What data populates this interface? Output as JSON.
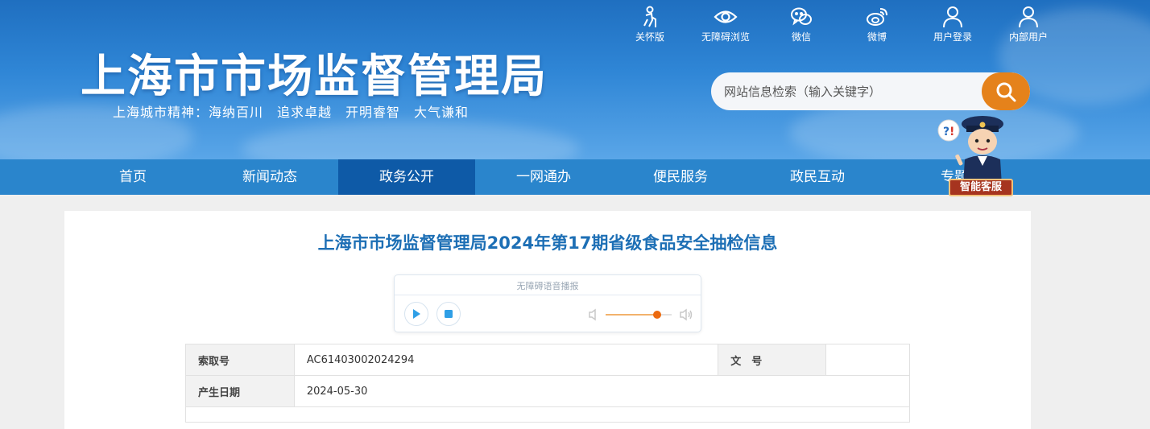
{
  "header": {
    "site_title": "上海市市场监督管理局",
    "site_slogan": "上海城市精神：海纳百川　追求卓越　开明睿智　大气谦和",
    "top_links": [
      {
        "label": "关怀版",
        "icon": "elderly-care-icon"
      },
      {
        "label": "无障碍浏览",
        "icon": "eye-icon"
      },
      {
        "label": "微信",
        "icon": "wechat-icon"
      },
      {
        "label": "微博",
        "icon": "weibo-icon"
      },
      {
        "label": "用户登录",
        "icon": "user-icon"
      },
      {
        "label": "内部用户",
        "icon": "user-icon"
      }
    ],
    "search": {
      "placeholder": "网站信息检索（输入关键字）",
      "value": ""
    }
  },
  "nav": {
    "items": [
      "首页",
      "新闻动态",
      "政务公开",
      "一网通办",
      "便民服务",
      "政民互动",
      "专题"
    ],
    "active_index": 2
  },
  "assistant": {
    "label": "智能客服"
  },
  "article": {
    "title": "上海市市场监督管理局2024年第17期省级食品安全抽检信息",
    "player_label": "无障碍语音播报",
    "volume": 0.8
  },
  "info_table": {
    "index_label": "索取号",
    "index_value": "AC61403002024294",
    "doc_label": "文　号",
    "doc_value": "",
    "date_label": "产生日期",
    "date_value": "2024-05-30"
  },
  "colors": {
    "header_blue": "#2f86d6",
    "nav_blue": "#2a85cc",
    "nav_active": "#0e5aa7",
    "search_orange": "#e5821b",
    "title_blue": "#1d6fb5"
  }
}
